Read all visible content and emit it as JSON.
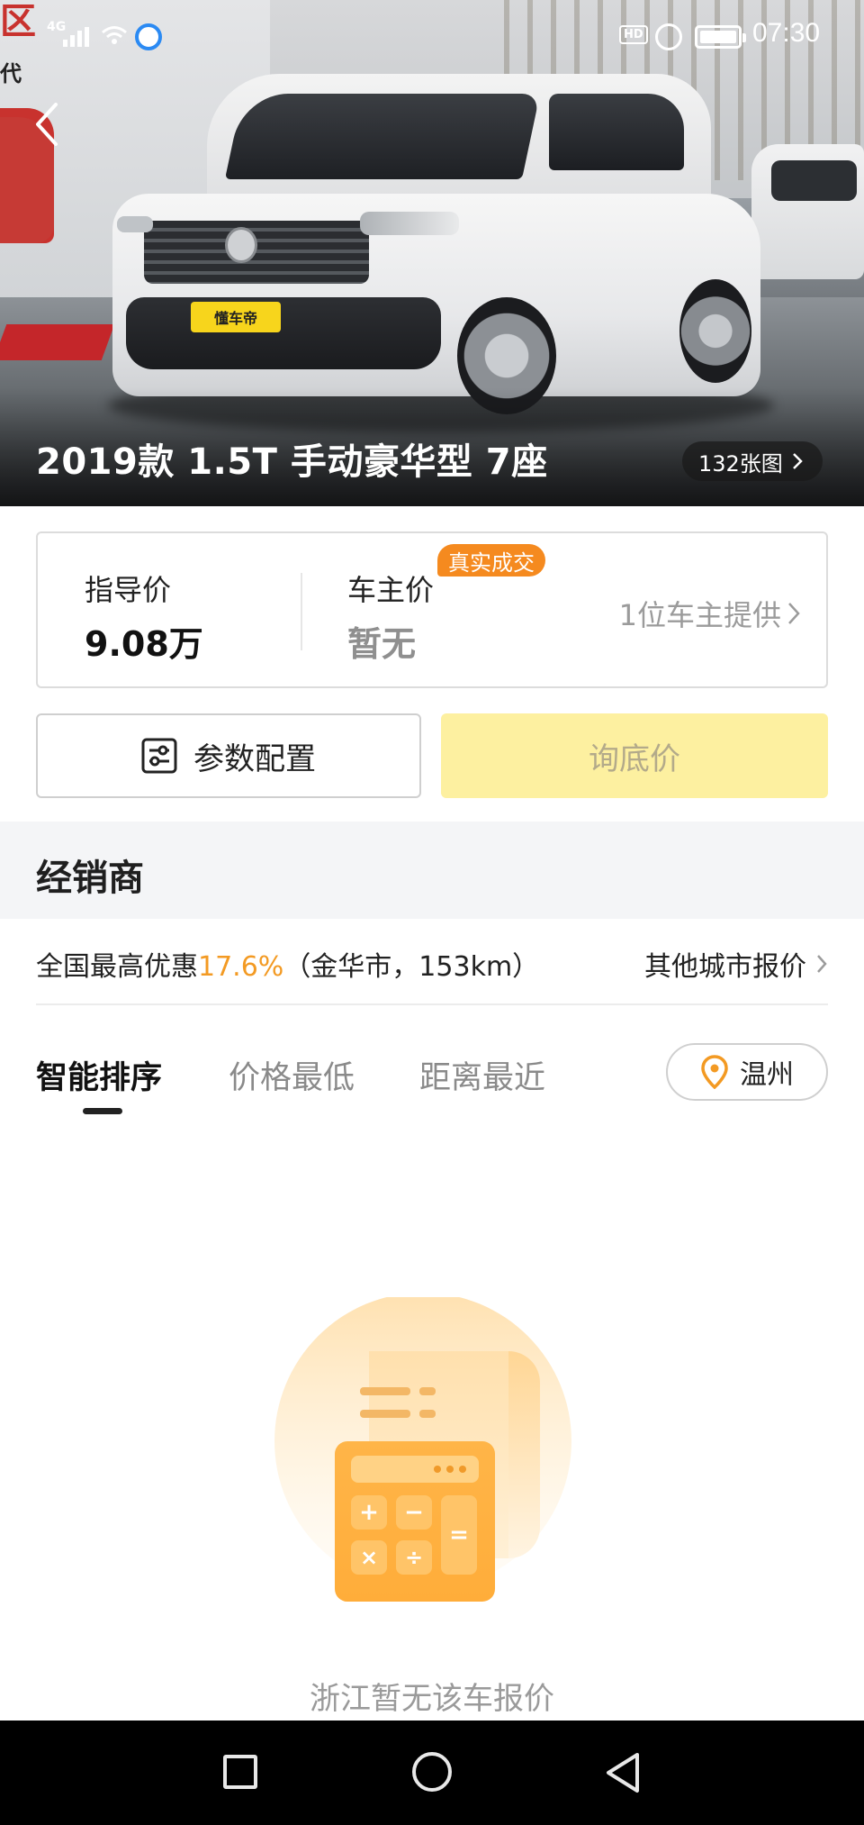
{
  "status_bar": {
    "network": "4G",
    "hd_label": "HD",
    "time": "07:30"
  },
  "hero": {
    "title": "2019款 1.5T 手动豪华型 7座",
    "photo_count": "132张图",
    "plate_text": "懂车帝",
    "left_sign_text": "区",
    "left_sign_sub": "代"
  },
  "price_card": {
    "guide_label": "指导价",
    "guide_value": "9.08万",
    "owner_label": "车主价",
    "owner_value": "暂无",
    "badge": "真实成交",
    "provider": "1位车主提供"
  },
  "actions": {
    "params_label": "参数配置",
    "inquiry_label": "询底价"
  },
  "dealers": {
    "section_title": "经销商",
    "promo_prefix": "全国最高优惠",
    "promo_rate": "17.6%",
    "promo_suffix": "（金华市，153km）",
    "other_cities": "其他城市报价",
    "sort_tabs": [
      "智能排序",
      "价格最低",
      "距离最近"
    ],
    "city": "温州",
    "empty_message": "浙江暂无该车报价"
  },
  "colors": {
    "accent_orange": "#f39a23",
    "inquiry_bg": "#fdf0a0",
    "section_bg": "#f4f5f7"
  },
  "icons": {
    "back": "chevron-left-icon",
    "photo_arrow": "chevron-right-icon",
    "params": "sliders-icon",
    "location": "location-pin-icon",
    "empty": "calculator-receipt-icon"
  }
}
